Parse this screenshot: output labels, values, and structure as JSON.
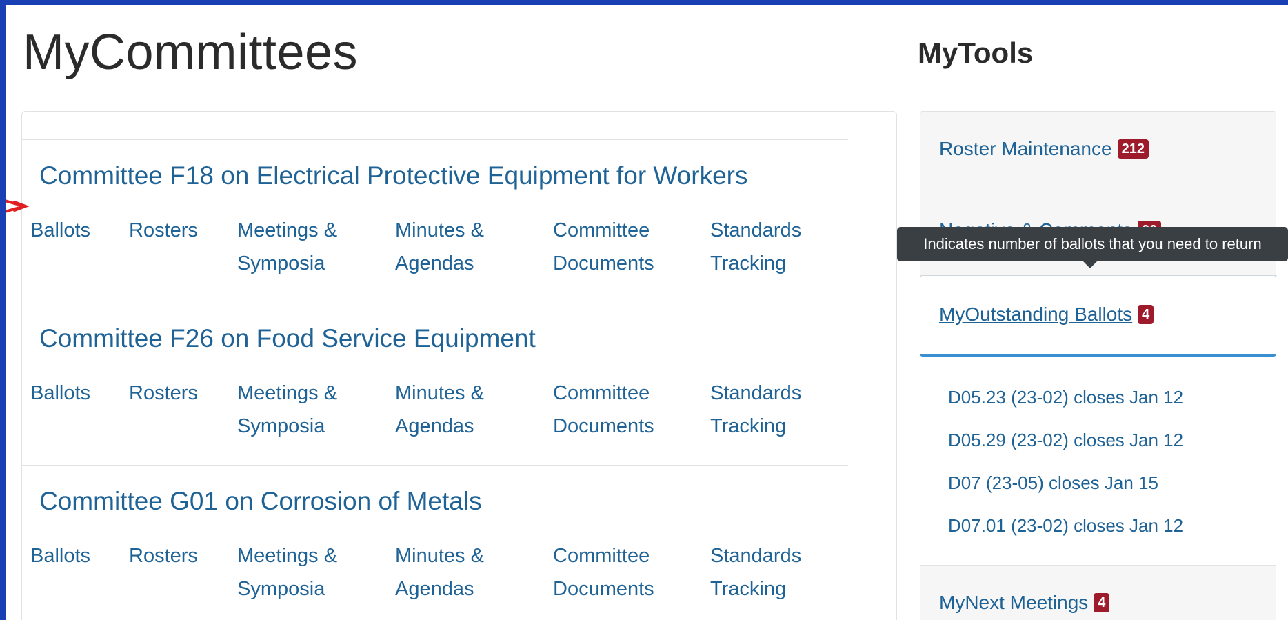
{
  "page_title": "MyCommittees",
  "tools_title": "MyTools",
  "committees": [
    {
      "name": "Committee F18 on Electrical Protective Equipment for Workers",
      "links": {
        "ballots": "Ballots",
        "rosters": "Rosters",
        "meetings_1": "Meetings &",
        "meetings_2": "Symposia",
        "minutes_1": "Minutes &",
        "minutes_2": "Agendas",
        "documents_1": "Committee",
        "documents_2": "Documents",
        "tracking_1": "Standards",
        "tracking_2": "Tracking"
      }
    },
    {
      "name": "Committee F26 on Food Service Equipment",
      "links": {
        "ballots": "Ballots",
        "rosters": "Rosters",
        "meetings_1": "Meetings &",
        "meetings_2": "Symposia",
        "minutes_1": "Minutes &",
        "minutes_2": "Agendas",
        "documents_1": "Committee",
        "documents_2": "Documents",
        "tracking_1": "Standards",
        "tracking_2": "Tracking"
      }
    },
    {
      "name": "Committee G01 on Corrosion of Metals",
      "links": {
        "ballots": "Ballots",
        "rosters": "Rosters",
        "meetings_1": "Meetings &",
        "meetings_2": "Symposia",
        "minutes_1": "Minutes &",
        "minutes_2": "Agendas",
        "documents_1": "Committee",
        "documents_2": "Documents",
        "tracking_1": "Standards",
        "tracking_2": "Tracking"
      }
    }
  ],
  "tools": {
    "roster_maintenance": {
      "label": "Roster Maintenance",
      "count": "212"
    },
    "negative_comments": {
      "label": "Negative & Comments",
      "count": "90"
    },
    "outstanding_ballots": {
      "label": "MyOutstanding Ballots",
      "count": "4"
    },
    "next_meetings": {
      "label": "MyNext Meetings",
      "count": "4"
    }
  },
  "ballot_items": [
    "D05.23 (23-02) closes Jan 12",
    "D05.29 (23-02) closes Jan 12",
    "D07 (23-05) closes Jan 15",
    "D07.01 (23-02) closes Jan 12"
  ],
  "tooltip": "Indicates number of ballots that you need to return",
  "colors": {
    "frame_border": "#1a3fb5",
    "link": "#1e6296",
    "badge": "#9e1b2c",
    "tooltip_bg": "#3a3f44",
    "active_underline": "#3a8fd0"
  }
}
